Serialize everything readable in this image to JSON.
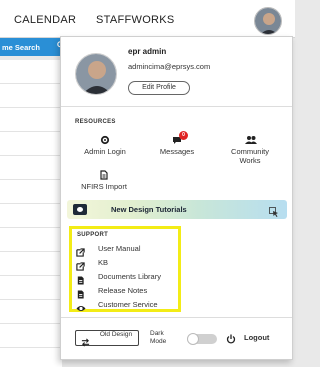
{
  "nav": {
    "calendar": "CALENDAR",
    "staffworks": "STAFFWORKS"
  },
  "background": {
    "search_label": "me Search"
  },
  "profile": {
    "name": "epr admin",
    "email": "admincima@eprsys.com",
    "edit_label": "Edit Profile"
  },
  "resources": {
    "title": "RESOURCES",
    "items": [
      {
        "label": "Admin Login",
        "icon": "gear-icon"
      },
      {
        "label": "Messages",
        "icon": "chat-icon",
        "badge": "0"
      },
      {
        "label": "Community Works",
        "icon": "people-icon"
      },
      {
        "label": "NFIRS Import",
        "icon": "document-icon"
      }
    ]
  },
  "tutorials": {
    "label": "New Design Tutorials",
    "icon": "video-icon"
  },
  "support": {
    "title": "SUPPORT",
    "items": [
      {
        "label": "User Manual",
        "icon": "external-link-icon"
      },
      {
        "label": "KB",
        "icon": "external-link-icon"
      },
      {
        "label": "Documents Library",
        "icon": "document-icon"
      },
      {
        "label": "Release Notes",
        "icon": "document-icon"
      },
      {
        "label": "Customer Service",
        "icon": "eye-icon"
      }
    ]
  },
  "footer": {
    "old_design": "Old Design",
    "dark_mode": "Dark Mode",
    "dark_mode_on": false,
    "logout": "Logout"
  },
  "colors": {
    "highlight": "#f3ec16",
    "badge": "#e02424",
    "search_bar": "#2a8fd6"
  }
}
